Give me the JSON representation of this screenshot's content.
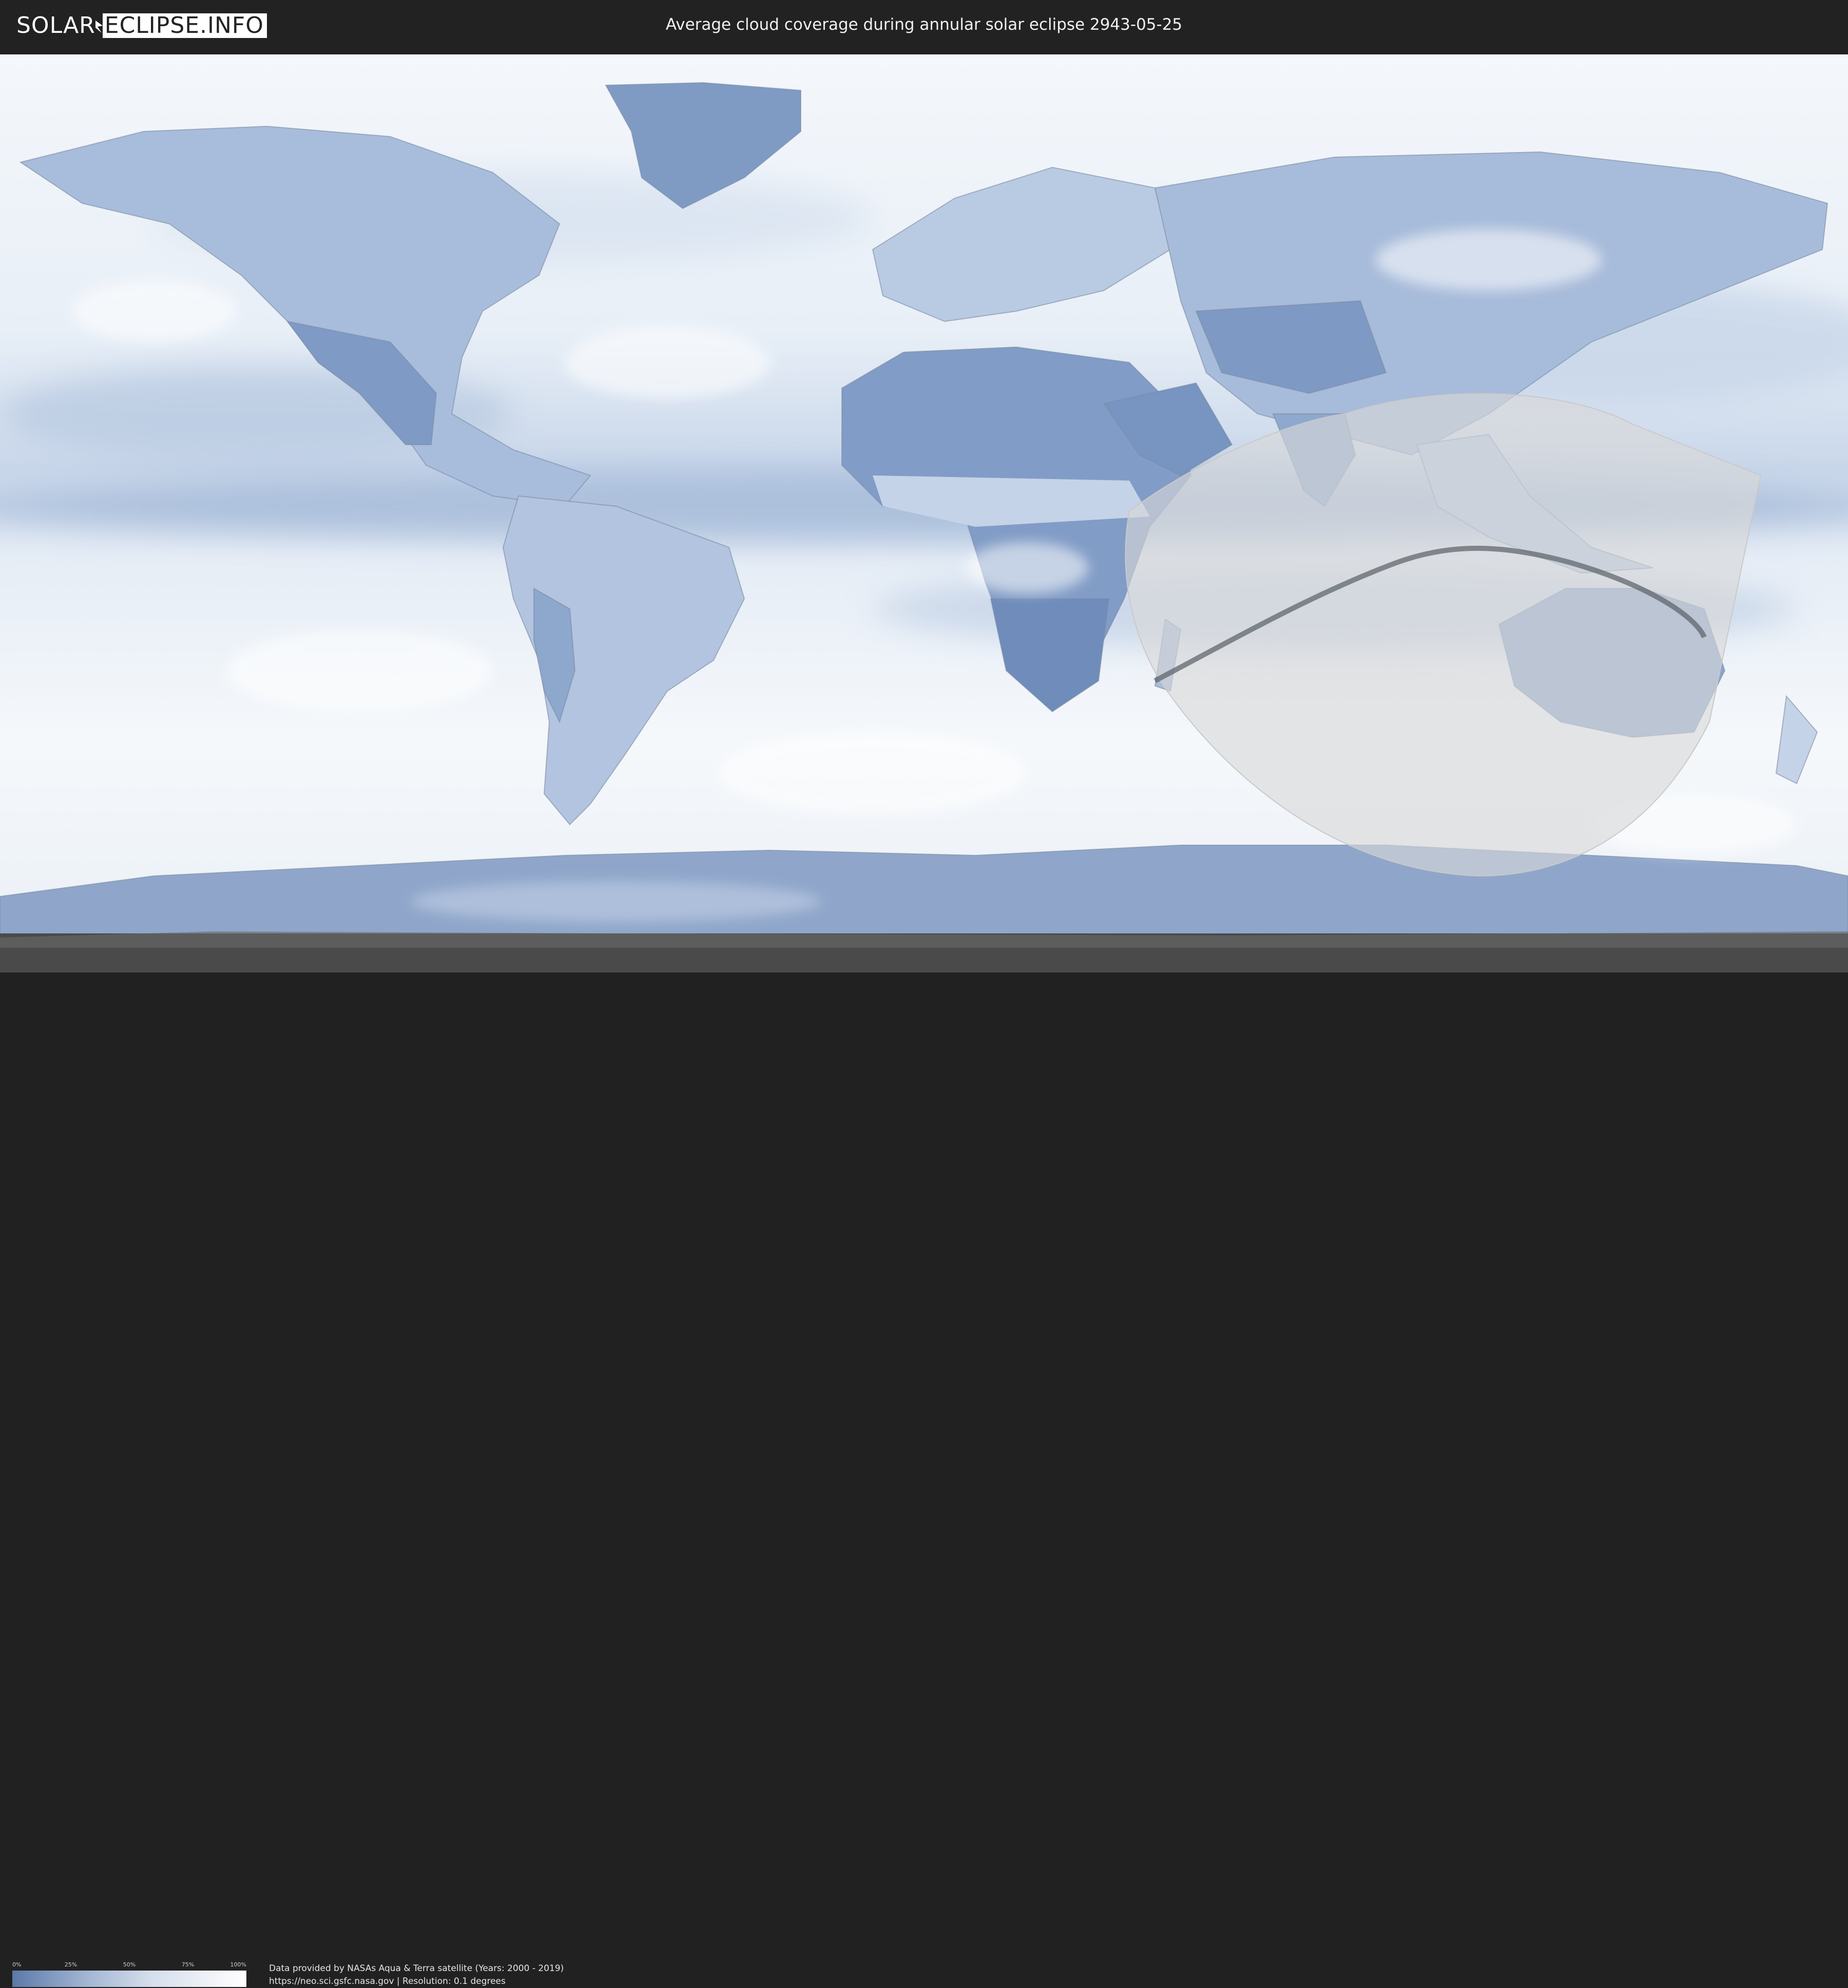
{
  "header": {
    "logo_left": "SOLAR",
    "logo_right": "ECLIPSE.INFO",
    "title": "Average cloud coverage during annular solar eclipse 2943-05-25"
  },
  "map": {
    "colors": {
      "ocean_clear": "#eef3f9",
      "cloud_low": "#6f8fbf",
      "eclipse_overlay": "#d9d9d9",
      "central_line": "#5a5f66",
      "polar_shadow": "#4a4a4a"
    }
  },
  "legend": {
    "ticks": [
      "0%",
      "25%",
      "50%",
      "75%",
      "100%"
    ],
    "gradient_colors": [
      "#5b79a8",
      "#9fb3d1",
      "#d6dfec",
      "#ffffff"
    ]
  },
  "source": {
    "line1": "Data provided by NASAs Aqua & Terra satellite (Years: 2000 - 2019)",
    "line2": "https://neo.sci.gsfc.nasa.gov | Resolution: 0.1 degrees"
  }
}
